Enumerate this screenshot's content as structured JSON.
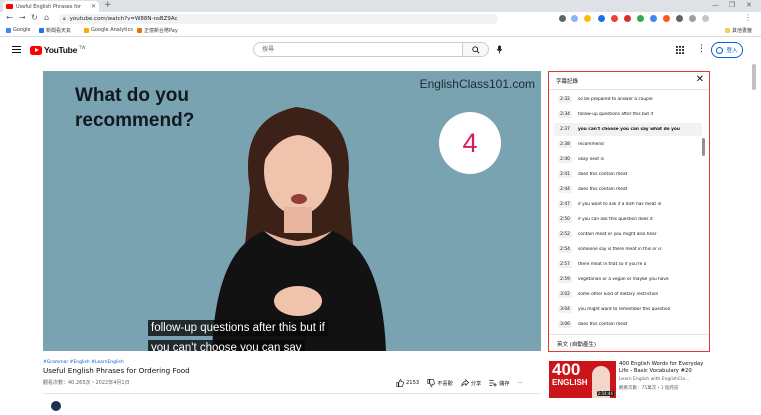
{
  "browser": {
    "tab_title": "Useful English Phrases for",
    "url": "youtube.com/watch?v=W88N-nsBZ9Ac",
    "bookmarks": [
      "Google",
      "新聞看天氣",
      "Google Analytics",
      "正億新台幣Pay",
      "其他書籤"
    ]
  },
  "header": {
    "brand": "YouTube",
    "region": "TW",
    "search_placeholder": "搜尋",
    "signin_label": "登入"
  },
  "video": {
    "slide_text_line1": "What do you",
    "slide_text_line2": "recommend?",
    "watermark": "EnglishClass101.com",
    "number_badge": "4",
    "caption_line1": "follow-up questions after this but if",
    "caption_line2": "you can't choose you can say"
  },
  "transcript": {
    "title": "字幕記錄",
    "language": "英文 (自動產生)",
    "segments": [
      {
        "time": "2:32",
        "text": "so be prepared to answer a couple"
      },
      {
        "time": "2:34",
        "text": "follow-up questions after this but if"
      },
      {
        "time": "2:37",
        "text": "you can't choose you can say what do you"
      },
      {
        "time": "2:38",
        "text": "recommend"
      },
      {
        "time": "2:40",
        "text": "okay next is"
      },
      {
        "time": "2:41",
        "text": "does this contain meat"
      },
      {
        "time": "2:44",
        "text": "does this contain meat"
      },
      {
        "time": "2:47",
        "text": "if you want to ask if a dish has meat in"
      },
      {
        "time": "2:50",
        "text": "if you can ask this question does it"
      },
      {
        "time": "2:52",
        "text": "contain meat or you might also hear"
      },
      {
        "time": "2:54",
        "text": "someone say is there meat in this or is"
      },
      {
        "time": "2:57",
        "text": "there meat in that so if you're a"
      },
      {
        "time": "2:59",
        "text": "vegetarian or a vegan or maybe you have"
      },
      {
        "time": "3:02",
        "text": "some other kind of dietary restriction"
      },
      {
        "time": "3:04",
        "text": "you might want to remember this question"
      },
      {
        "time": "3:06",
        "text": "does this contain meat"
      }
    ]
  },
  "info": {
    "tags": "#Grammar #English #LearnEnglish",
    "title": "Useful English Phrases for Ordering Food",
    "views": "觀看次數：40,265次・2022年4月1日",
    "likes": "2153",
    "dislike_label": "不喜歡",
    "share_label": "分享",
    "save_label": "儲存"
  },
  "recommended": {
    "thumb_big": "400",
    "thumb_mid": "ENGLISH",
    "duration": "2:54:46",
    "title": "400 English Words for Everyday Life - Basic Vocabulary #20",
    "channel": "Learn English with EnglishCla...",
    "meta": "觀看次數：75萬次・1 個月前"
  }
}
